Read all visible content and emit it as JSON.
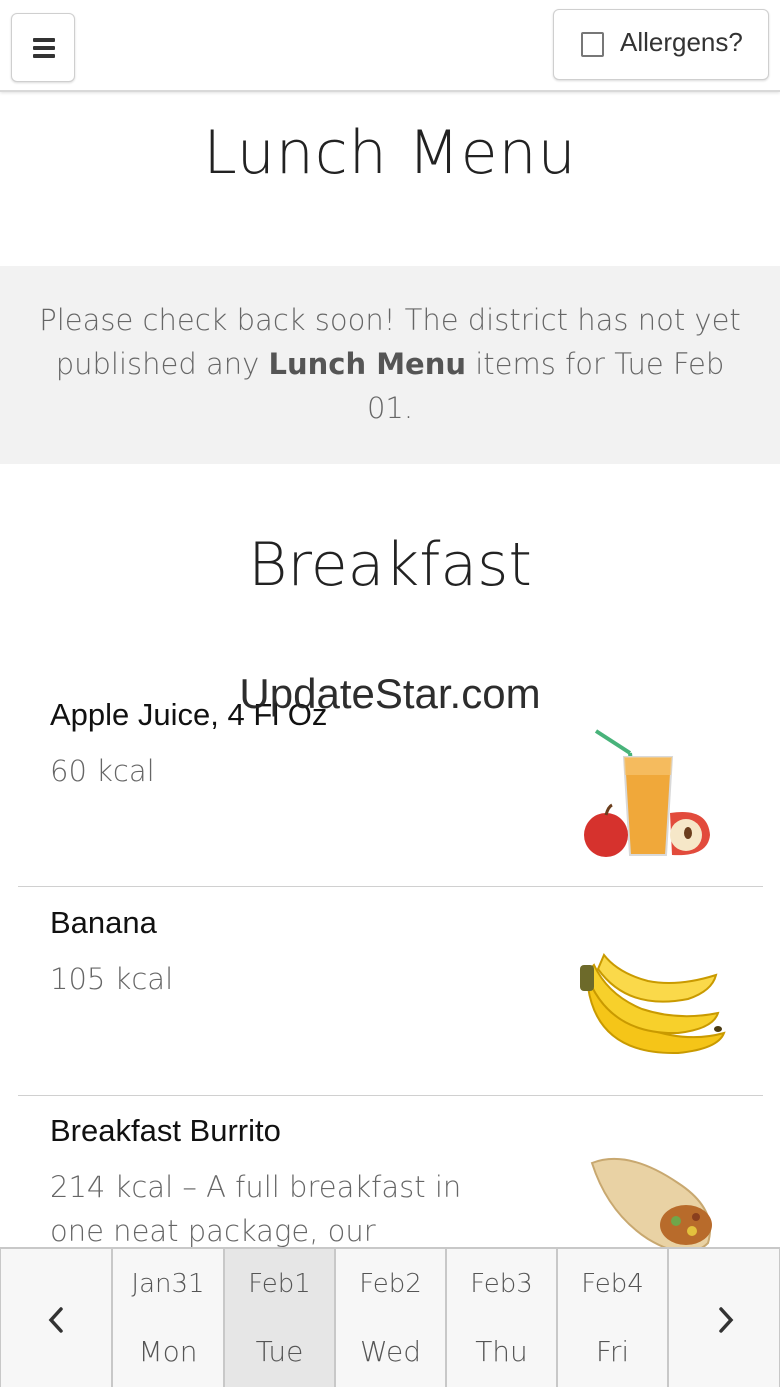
{
  "header": {
    "menu_icon": "hamburger-icon",
    "allergens_label": "Allergens?",
    "allergens_checked": false
  },
  "page_title": "Lunch Menu",
  "notice": {
    "before": "Please check back soon! The district has not yet published any ",
    "bold": "Lunch Menu",
    "after": " items for Tue Feb 01."
  },
  "section_title": "Breakfast",
  "watermark": "UpdateStar.com",
  "items": [
    {
      "name": "Apple Juice, 4 Fl Oz",
      "desc": "60 kcal",
      "icon": "apple-juice-image"
    },
    {
      "name": "Banana",
      "desc": "105 kcal",
      "icon": "banana-image"
    },
    {
      "name": "Breakfast Burrito",
      "desc": "214 kcal – A full breakfast in one neat package, our",
      "icon": "burrito-image"
    }
  ],
  "days": [
    {
      "date": "Jan31",
      "day": "Mon",
      "active": false
    },
    {
      "date": "Feb1",
      "day": "Tue",
      "active": true
    },
    {
      "date": "Feb2",
      "day": "Wed",
      "active": false
    },
    {
      "date": "Feb3",
      "day": "Thu",
      "active": false
    },
    {
      "date": "Feb4",
      "day": "Fri",
      "active": false
    }
  ],
  "nav": {
    "prev_icon": "chevron-left-icon",
    "next_icon": "chevron-right-icon"
  }
}
